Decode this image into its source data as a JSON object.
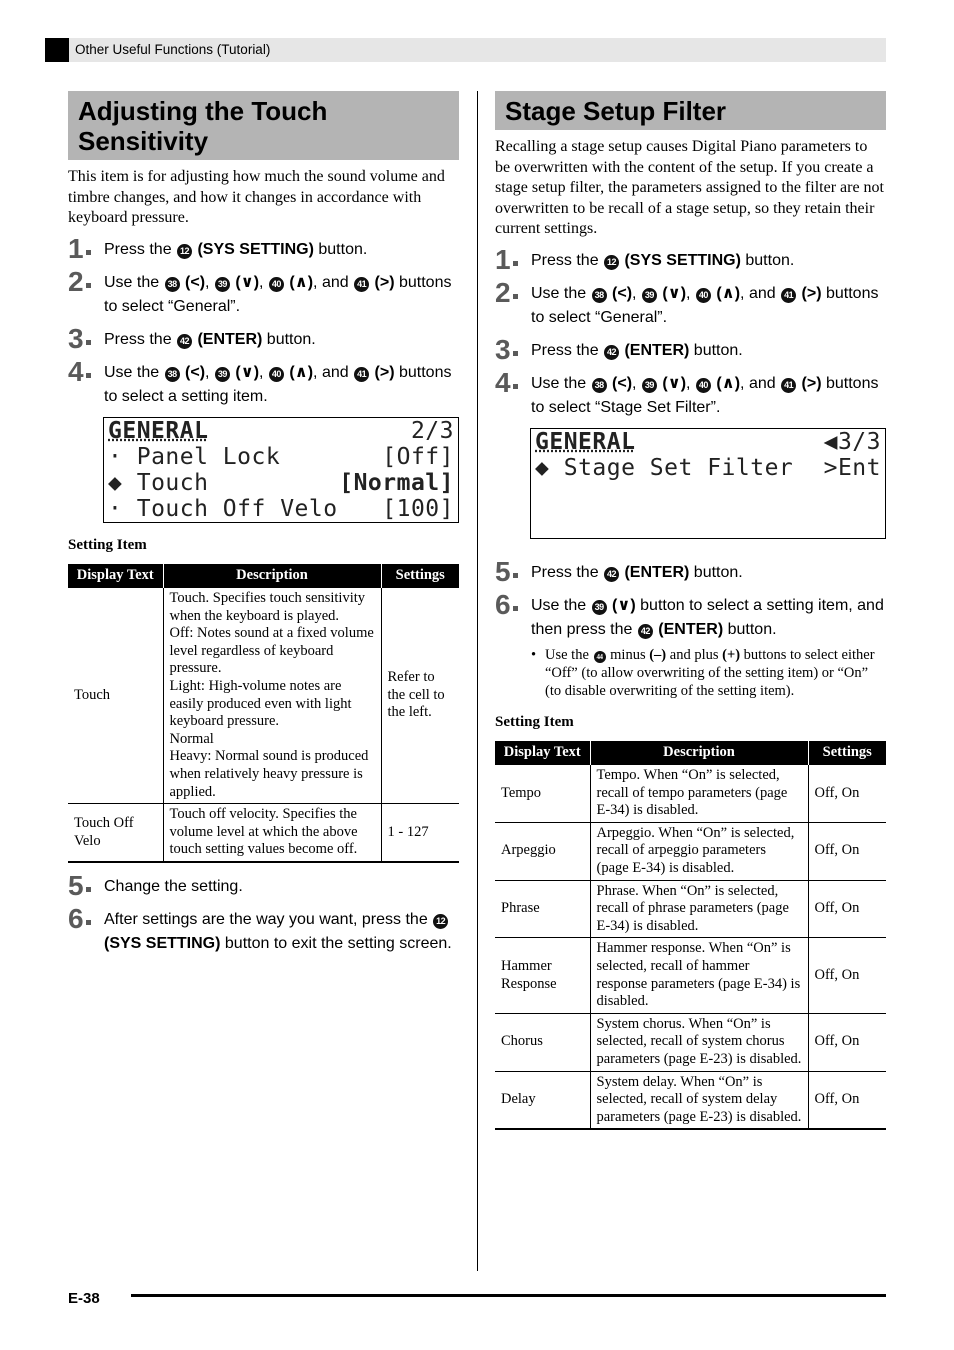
{
  "header": {
    "section": "Other Useful Functions (Tutorial)"
  },
  "left": {
    "title": "Adjusting the Touch Sensitivity",
    "intro": "This item is for adjusting how much the sound volume and timbre changes, and how it changes in accordance with keyboard pressure.",
    "steps": [
      {
        "num": "1",
        "parts": [
          "Press the ",
          "12",
          " (SYS SETTING)",
          " button."
        ]
      },
      {
        "num": "2",
        "text_a": "Use the ",
        "btn_left": "38",
        "btn_down": "39",
        "btn_up": "40",
        "btn_right": "41",
        "and": ", and ",
        "text_b": " buttons to select “General”."
      },
      {
        "num": "3",
        "parts": [
          "Press the ",
          "42",
          " (ENTER)",
          " button."
        ]
      },
      {
        "num": "4",
        "text_a": "Use the ",
        "btn_left": "38",
        "btn_down": "39",
        "btn_up": "40",
        "btn_right": "41",
        "and": ", and ",
        "text_b": " buttons to select a setting item."
      },
      {
        "num": "5",
        "text": "Change the setting."
      },
      {
        "num": "6",
        "text_a": "After settings are the way you want, press the ",
        "btn": "12",
        "bold": " (SYS SETTING)",
        "text_b": " button to exit the setting screen."
      }
    ],
    "lcd": {
      "header": "GENERAL",
      "page": "2/3",
      "rows": [
        {
          "marker": "·",
          "label": "Panel Lock",
          "value": "[Off]"
        },
        {
          "marker": "◆",
          "label": "Touch",
          "value": "[Normal]"
        },
        {
          "marker": "·",
          "label": "Touch Off Velo",
          "value": "[100]"
        }
      ]
    },
    "table_label": "Setting Item",
    "table": {
      "headers": [
        "Display Text",
        "Description",
        "Settings"
      ],
      "rows": [
        [
          "Touch",
          "Touch. Specifies touch sensitivity when the keyboard is played.\nOff: Notes sound at a fixed volume level regardless of keyboard pressure.\nLight: High-volume notes are easily produced even with light keyboard pressure.\nNormal\nHeavy: Normal sound is produced when relatively heavy pressure is applied.",
          "Refer to the cell to the left."
        ],
        [
          "Touch Off Velo",
          "Touch off velocity. Specifies the volume level at which the above touch setting values become off.",
          "1 - 127"
        ]
      ]
    }
  },
  "right": {
    "title": "Stage Setup Filter",
    "intro": "Recalling a stage setup causes Digital Piano parameters to be overwritten with the content of the setup. If you create a stage setup filter, the parameters assigned to the filter are not overwritten to be recall of a stage setup, so they retain their current settings.",
    "steps": [
      {
        "num": "1",
        "parts": [
          "Press the ",
          "12",
          " (SYS SETTING)",
          " button."
        ]
      },
      {
        "num": "2",
        "text_a": "Use the ",
        "btn_left": "38",
        "btn_down": "39",
        "btn_up": "40",
        "btn_right": "41",
        "and": ", and ",
        "text_b": " buttons to select “General”."
      },
      {
        "num": "3",
        "parts": [
          "Press the ",
          "42",
          " (ENTER)",
          " button."
        ]
      },
      {
        "num": "4",
        "text_a": "Use the ",
        "btn_left": "38",
        "btn_down": "39",
        "btn_up": "40",
        "btn_right": "41",
        "and": ", and ",
        "text_b": " buttons to select “Stage Set Filter”."
      },
      {
        "num": "5",
        "parts": [
          "Press the ",
          "42",
          " (ENTER)",
          " button."
        ]
      },
      {
        "num": "6",
        "text_a": "Use the ",
        "btn1": "39",
        "mid": " button to select a setting item, and then press the ",
        "btn2": "42",
        "bold": " (ENTER)",
        "text_b": " button."
      }
    ],
    "bullet": {
      "a": "Use the ",
      "btn": "44",
      "b": " minus ",
      "minus": "(–)",
      "c": " and plus ",
      "plus": "(+)",
      "d": " buttons to select either “Off” (to allow overwriting of the setting item) or “On” (to disable overwriting of the setting item)."
    },
    "lcd": {
      "header": "GENERAL",
      "page": "◀3/3",
      "rows": [
        {
          "marker": "◆",
          "label": "Stage Set Filter",
          "value": ">Ent"
        }
      ]
    },
    "table_label": "Setting Item",
    "table": {
      "headers": [
        "Display Text",
        "Description",
        "Settings"
      ],
      "rows": [
        [
          "Tempo",
          "Tempo. When “On” is selected, recall of tempo parameters (page E-34) is disabled.",
          "Off, On"
        ],
        [
          "Arpeggio",
          "Arpeggio. When “On” is selected, recall of arpeggio parameters (page E-34) is disabled.",
          "Off, On"
        ],
        [
          "Phrase",
          "Phrase. When “On” is selected, recall of phrase parameters (page E-34) is disabled.",
          "Off, On"
        ],
        [
          "Hammer Response",
          "Hammer response. When “On” is selected, recall of hammer response parameters (page E-34) is disabled.",
          "Off, On"
        ],
        [
          "Chorus",
          "System chorus. When “On” is selected, recall of system chorus parameters (page E-23) is disabled.",
          "Off, On"
        ],
        [
          "Delay",
          "System delay. When “On” is selected, recall of system delay parameters (page E-23) is disabled.",
          "Off, On"
        ]
      ]
    }
  },
  "arrows": {
    "left": "(<)",
    "down": "(∨)",
    "up": "(∧)",
    "right": "(>)"
  },
  "footer": {
    "page": "E-38"
  }
}
